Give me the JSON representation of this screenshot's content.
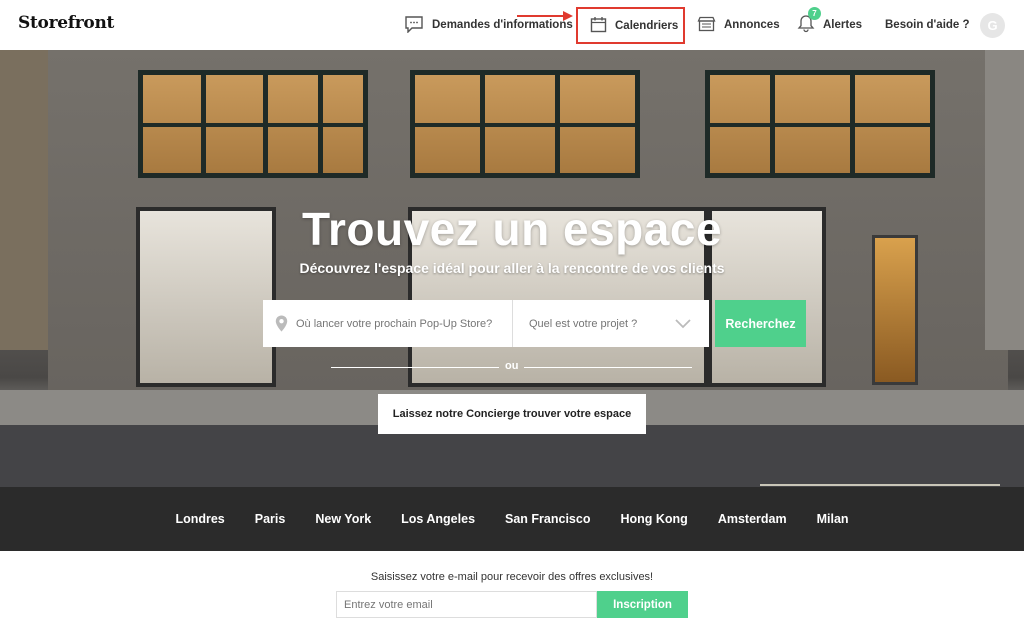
{
  "header": {
    "logo": "Storefront",
    "nav": {
      "requests": "Demandes d'informations",
      "calendars": "Calendriers",
      "listings": "Annonces",
      "alerts": "Alertes",
      "alerts_count": "7",
      "help": "Besoin d'aide ?"
    },
    "avatar_initial": "G"
  },
  "hero": {
    "title": "Trouvez un espace",
    "subtitle": "Découvrez l'espace idéal pour aller à la rencontre de vos clients",
    "location_placeholder": "Où lancer votre prochain Pop-Up Store?",
    "project_placeholder": "Quel est votre projet ?",
    "search_button": "Recherchez",
    "or_text": "ou",
    "concierge_button": "Laissez notre Concierge trouver votre espace"
  },
  "cities": [
    "Londres",
    "Paris",
    "New York",
    "Los Angeles",
    "San Francisco",
    "Hong Kong",
    "Amsterdam",
    "Milan"
  ],
  "newsletter": {
    "label": "Saisissez votre e-mail pour recevoir des offres exclusives!",
    "email_placeholder": "Entrez votre email",
    "subscribe_button": "Inscription"
  },
  "colors": {
    "accent": "#4fd08c",
    "highlight": "#e03a2f",
    "dark_bar": "#2b2b2b"
  },
  "icons": [
    "chat-bubble-icon",
    "calendar-icon",
    "listing-icon",
    "bell-icon",
    "location-pin-icon",
    "chevron-down-icon",
    "arrow-icon"
  ]
}
